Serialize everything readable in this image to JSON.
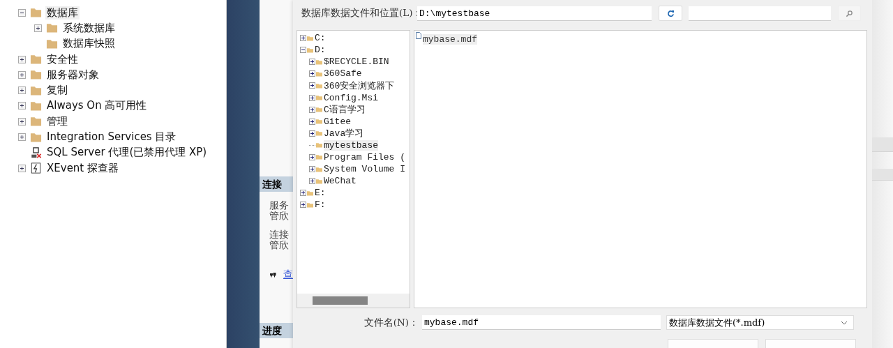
{
  "explorer": {
    "items": [
      {
        "label": "数据库",
        "kind": "folder",
        "expandable": true,
        "expanded": true,
        "selected": true,
        "children": [
          {
            "label": "系统数据库",
            "kind": "folder",
            "expandable": true,
            "expanded": false,
            "selected": false
          },
          {
            "label": "数据库快照",
            "kind": "folder",
            "expandable": false,
            "selected": false
          }
        ]
      },
      {
        "label": "安全性",
        "kind": "folder",
        "expandable": true,
        "expanded": false,
        "selected": false
      },
      {
        "label": "服务器对象",
        "kind": "folder",
        "expandable": true,
        "expanded": false,
        "selected": false
      },
      {
        "label": "复制",
        "kind": "folder",
        "expandable": true,
        "expanded": false,
        "selected": false
      },
      {
        "label": "Always On 高可用性",
        "kind": "folder",
        "expandable": true,
        "expanded": false,
        "selected": false
      },
      {
        "label": "管理",
        "kind": "folder",
        "expandable": true,
        "expanded": false,
        "selected": false
      },
      {
        "label": "Integration Services 目录",
        "kind": "folder",
        "expandable": true,
        "expanded": false,
        "selected": false
      },
      {
        "label": "SQL Server 代理(已禁用代理 XP)",
        "kind": "agent",
        "expandable": false,
        "selected": false
      },
      {
        "label": "XEvent 探查器",
        "kind": "xevent",
        "expandable": true,
        "expanded": false,
        "selected": false
      }
    ]
  },
  "side_panel": {
    "sections": [
      {
        "title": "连接",
        "lines": [
          {
            "kind": "text",
            "parts": [
              "服务",
              "管欣"
            ]
          },
          {
            "kind": "text",
            "parts": [
              "连接",
              "管欣"
            ]
          },
          {
            "kind": "link",
            "parts": [
              "查"
            ]
          }
        ]
      },
      {
        "title": "进度"
      }
    ]
  },
  "dialog": {
    "location_label": "数据库数据文件和位置(L)：",
    "path": "D:\\mytestbase",
    "tree": [
      {
        "label": "C:",
        "expandable": true,
        "expanded": false,
        "selected": false
      },
      {
        "label": "D:",
        "expandable": true,
        "expanded": true,
        "selected": false,
        "children": [
          {
            "label": "$RECYCLE.BIN",
            "expandable": true,
            "expanded": false,
            "selected": false
          },
          {
            "label": "360Safe",
            "expandable": true,
            "expanded": false,
            "selected": false
          },
          {
            "label": "360安全浏览器下",
            "expandable": true,
            "expanded": false,
            "selected": false
          },
          {
            "label": "Config.Msi",
            "expandable": true,
            "expanded": false,
            "selected": false
          },
          {
            "label": "C语言学习",
            "expandable": true,
            "expanded": false,
            "selected": false
          },
          {
            "label": "Gitee",
            "expandable": true,
            "expanded": false,
            "selected": false
          },
          {
            "label": "Java学习",
            "expandable": true,
            "expanded": false,
            "selected": false
          },
          {
            "label": "mytestbase",
            "expandable": false,
            "selected": true
          },
          {
            "label": "Program Files (",
            "expandable": true,
            "expanded": false,
            "selected": false
          },
          {
            "label": "System Volume I",
            "expandable": true,
            "expanded": false,
            "selected": false
          },
          {
            "label": "WeChat",
            "expandable": true,
            "expanded": false,
            "selected": false
          }
        ]
      },
      {
        "label": "E:",
        "expandable": true,
        "expanded": false,
        "selected": false
      },
      {
        "label": "F:",
        "expandable": true,
        "expanded": false,
        "selected": false
      }
    ],
    "files": [
      {
        "name": "mybase.mdf",
        "selected": true
      }
    ],
    "filename_label": "文件名(N)：",
    "filename": "mybase.mdf",
    "filter": "数据库数据文件(*.mdf)"
  }
}
